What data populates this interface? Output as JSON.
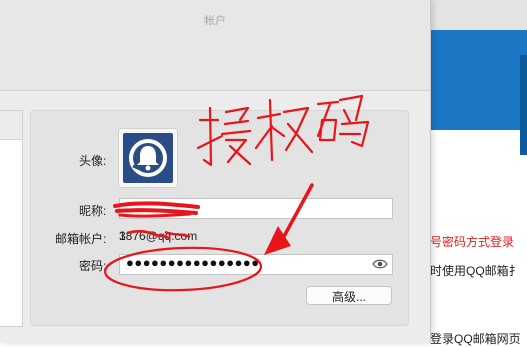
{
  "window": {
    "title": "帐户"
  },
  "form": {
    "avatar_label": "头像:",
    "nickname_label": "昵称:",
    "nickname_value": "",
    "email_label": "邮箱帐户:",
    "email_value": "1",
    "email_value_visible": "        3876@qq.com",
    "password_label": "密码:",
    "password_dots": "●●●●●●●●●●●●●●●●",
    "advanced_button": "高级..."
  },
  "annotation": {
    "handwritten_text": "授权码",
    "color": "#e8151b"
  },
  "background_page": {
    "red_text": "号密码方式登录",
    "line2": "时使用QQ邮箱扌",
    "line3": "登录QQ邮箱网页",
    "blue_color": "#1b77c4"
  }
}
